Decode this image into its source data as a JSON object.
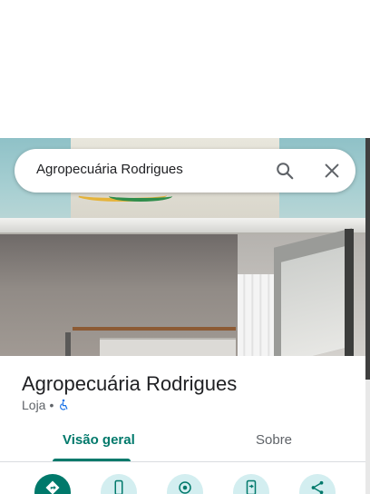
{
  "search": {
    "query": "Agropecuária Rodrigues"
  },
  "place": {
    "name": "Agropecuária Rodrigues",
    "category": "Loja",
    "separator": "•"
  },
  "tabs": [
    {
      "label": "Visão geral",
      "active": true
    },
    {
      "label": "Sobre",
      "active": false
    }
  ],
  "actions": [
    {
      "icon": "directions-icon",
      "style": "primary"
    },
    {
      "icon": "phone-icon",
      "style": "secondary"
    },
    {
      "icon": "nearby-icon",
      "style": "secondary"
    },
    {
      "icon": "send-to-phone-icon",
      "style": "secondary"
    },
    {
      "icon": "share-icon",
      "style": "secondary"
    }
  ],
  "colors": {
    "accent": "#00796b",
    "action_bg": "#d3eef0",
    "accessibility_icon": "#1a73e8"
  }
}
